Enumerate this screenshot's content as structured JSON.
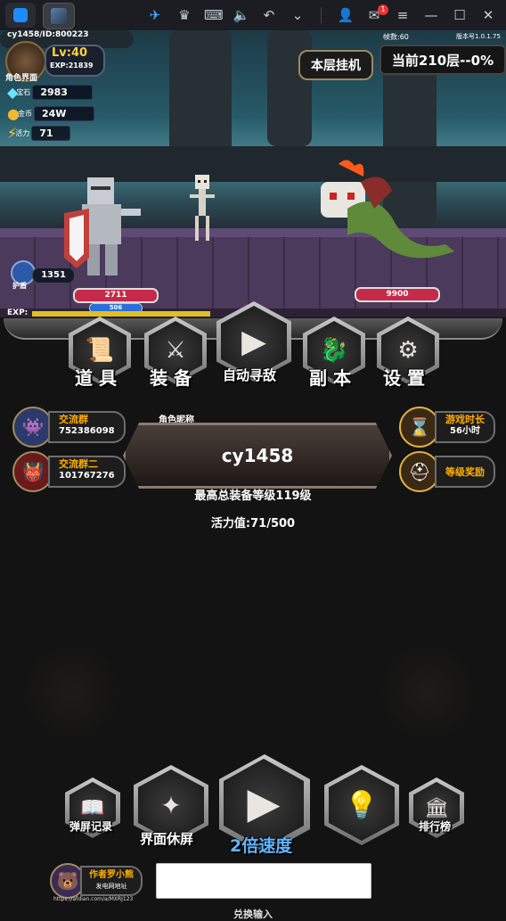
{
  "window": {
    "tabs": [
      {
        "name": "multi-instance-tab"
      },
      {
        "name": "game-tab"
      }
    ],
    "notification_count": "1",
    "toolbar_icons": [
      "tool-icon",
      "crown-icon",
      "keyboard-icon",
      "volume-icon",
      "back-icon",
      "chevron-down-icon",
      "account-icon",
      "mail-icon",
      "menu-icon",
      "minimize-icon",
      "maximize-icon",
      "close-icon"
    ]
  },
  "hud": {
    "player_id": "cy1458/ID:800223",
    "fps": "帧数:60",
    "version": "版本号1.0.1.75",
    "level": "Lv:40",
    "exp": "EXP:21839",
    "character_label": "角色界面",
    "gems_label": "宝石",
    "gems": "2983",
    "gold_label": "金币",
    "gold": "24W",
    "energy_label": "活力",
    "energy": "71",
    "idle_button": "本层挂机",
    "floor_status": "当前210层--0%",
    "shield_label": "护盾",
    "shield_value": "1351",
    "player_hp": "2711",
    "player_mp": "506",
    "enemy_hp": "9900",
    "exp_bar_label": "EXP:"
  },
  "menu": {
    "items": [
      {
        "label": "道 具",
        "icon": "scroll-icon"
      },
      {
        "label": "装 备",
        "icon": "sword-icon"
      },
      {
        "label": "自动寻敌",
        "icon": "play-icon"
      },
      {
        "label": "副 本",
        "icon": "dragon-icon"
      },
      {
        "label": "设 置",
        "icon": "gear-icon"
      }
    ]
  },
  "left_links": [
    {
      "title": "交流群",
      "value": "752386098"
    },
    {
      "title": "交流群二",
      "value": "101767276"
    }
  ],
  "right_links": [
    {
      "title": "游戏时长",
      "value": "56小时"
    },
    {
      "title": "等级奖励"
    }
  ],
  "profile": {
    "nickname_label": "角色昵称",
    "nickname": "cy1458",
    "max_equip_level": "最高总装备等级119级",
    "energy_text": "活力值:71/500"
  },
  "bottom": {
    "log_label": "弹屏记录",
    "sleep_label": "界面休屏",
    "speed_label": "2倍速度",
    "ranking_label": "排行榜",
    "author_label": "作者罗小熊",
    "author_sub": "发电网地址",
    "author_url": "https://afdian.com/a/MXRJ123",
    "redeem_label": "兑换输入",
    "redeem_value": ""
  }
}
